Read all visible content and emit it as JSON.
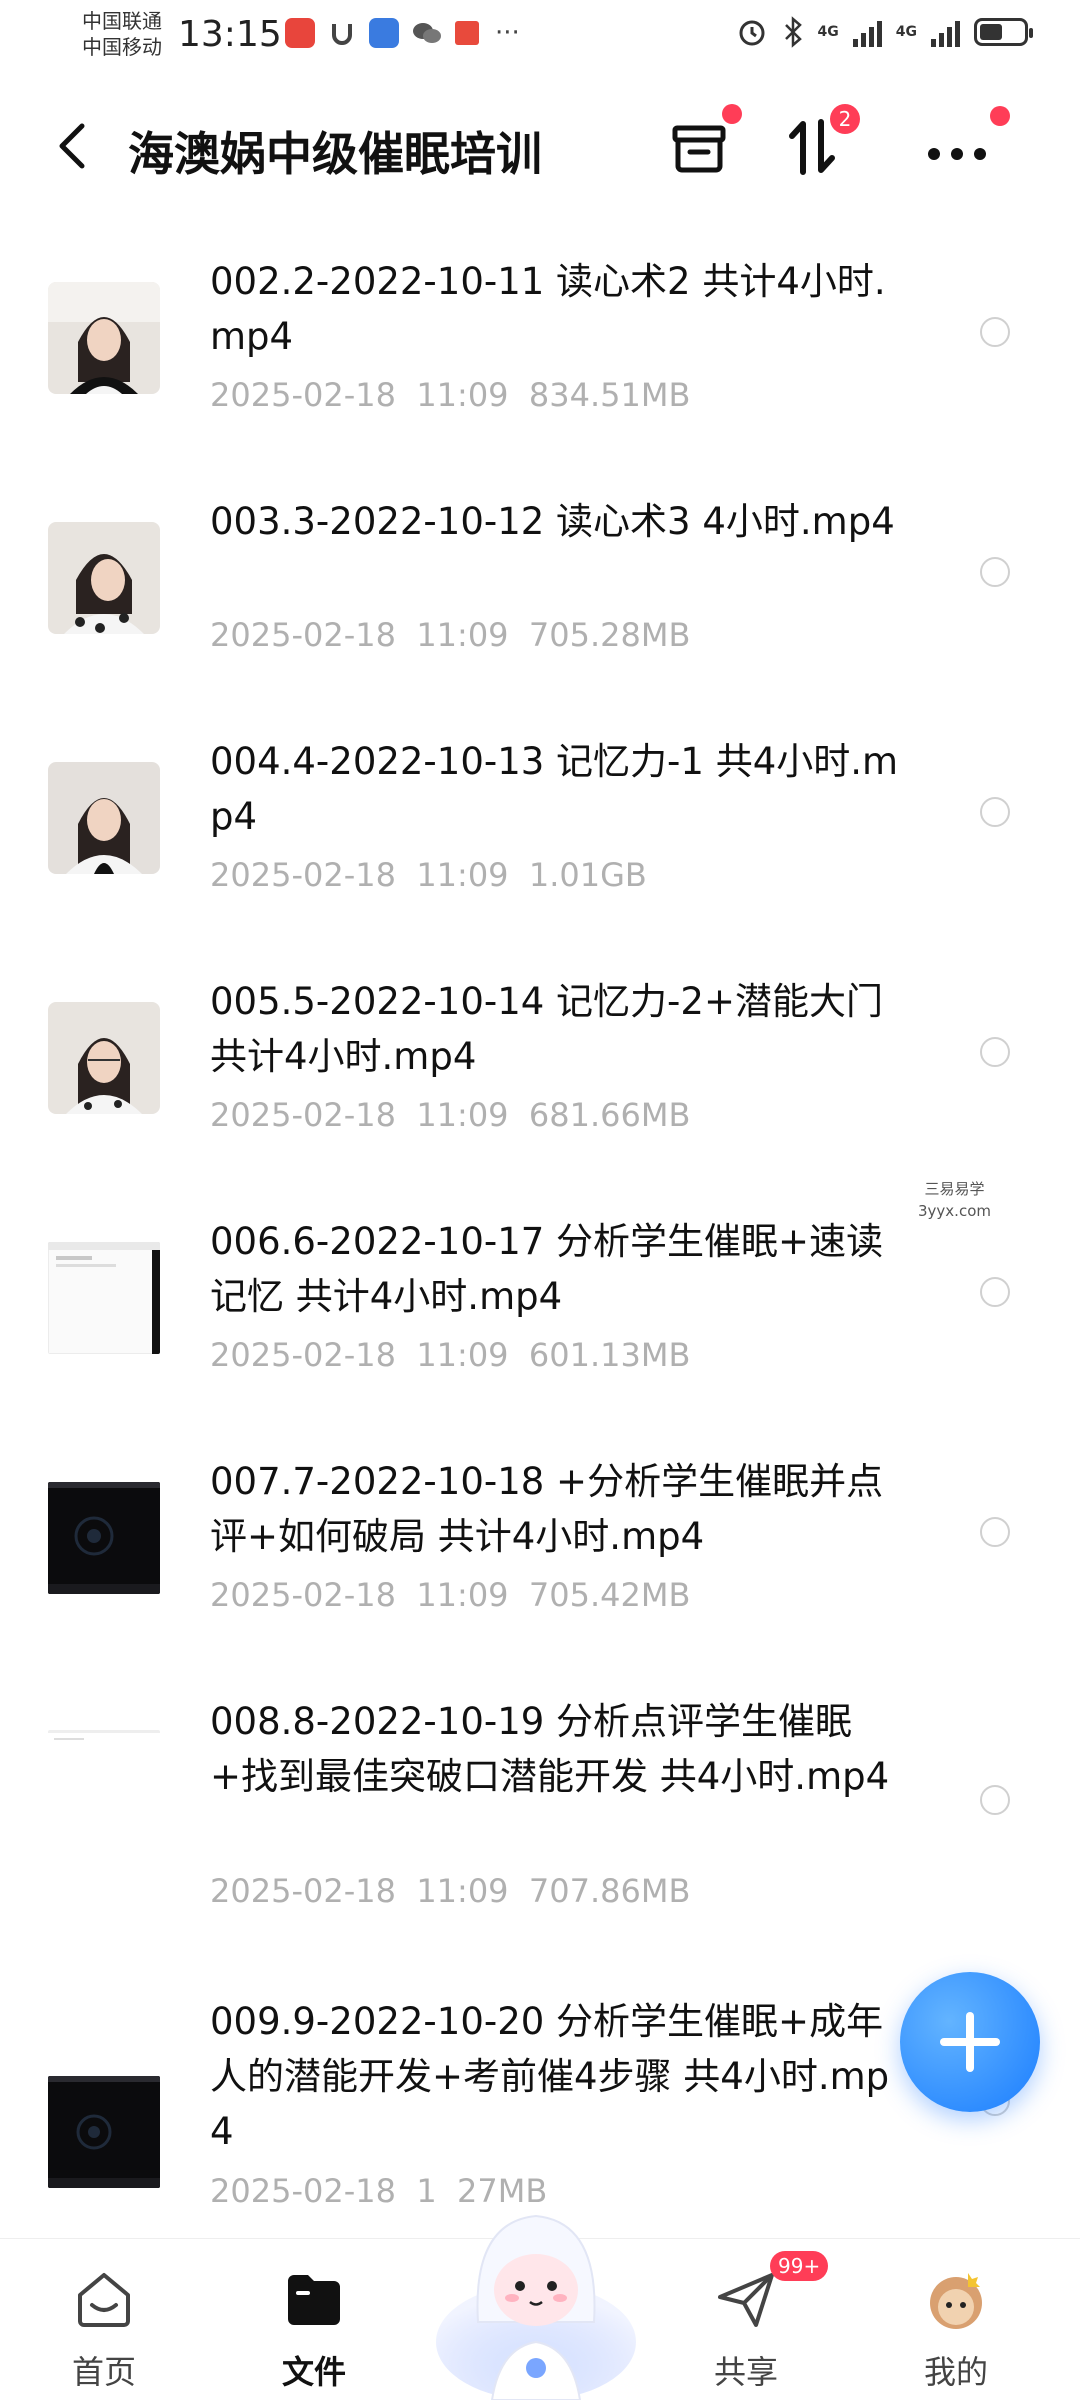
{
  "status_bar": {
    "carrier_1": "中国联通",
    "carrier_2": "中国移动",
    "time": "13:15",
    "network_1": "4G",
    "network_2": "4G"
  },
  "header": {
    "back_icon": "chevron-left-icon",
    "title": "海澳娲中级催眠培训",
    "transfer_badge": "2"
  },
  "files": [
    {
      "name": "002.2-2022-10-11 读心术2 共计4小时.mp4",
      "date": "2025-02-18",
      "time": "11:09",
      "size": "834.51MB",
      "thumb": "portrait"
    },
    {
      "name": "003.3-2022-10-12 读心术3  4小时.mp4",
      "date": "2025-02-18",
      "time": "11:09",
      "size": "705.28MB",
      "thumb": "portrait"
    },
    {
      "name": "004.4-2022-10-13 记忆力-1 共4小时.mp4",
      "date": "2025-02-18",
      "time": "11:09",
      "size": "1.01GB",
      "thumb": "portrait"
    },
    {
      "name": "005.5-2022-10-14 记忆力-2+潜能大门  共计4小时.mp4",
      "date": "2025-02-18",
      "time": "11:09",
      "size": "681.66MB",
      "thumb": "portrait"
    },
    {
      "name": "006.6-2022-10-17 分析学生催眠+速读记忆 共计4小时.mp4",
      "date": "2025-02-18",
      "time": "11:09",
      "size": "601.13MB",
      "thumb": "screen-light"
    },
    {
      "name": "007.7-2022-10-18 +分析学生催眠并点评+如何破局 共计4小时.mp4",
      "date": "2025-02-18",
      "time": "11:09",
      "size": "705.42MB",
      "thumb": "screen-dark"
    },
    {
      "name": "008.8-2022-10-19 分析点评学生催眠+找到最佳突破口潜能开发 共4小时.mp4",
      "date": "2025-02-18",
      "time": "11:09",
      "size": "707.86MB",
      "thumb": "blank"
    },
    {
      "name": "009.9-2022-10-20 分析学生催眠+成年人的潜能开发+考前催4步骤 共4小时.mp4",
      "date": "2025-02-18",
      "time": "1",
      "size": "27MB",
      "thumb": "screen-dark"
    }
  ],
  "watermark": {
    "line1": "三易易学",
    "line2": "3yyx.com"
  },
  "tabs": [
    {
      "label": "首页",
      "icon": "home-icon",
      "active": false
    },
    {
      "label": "文件",
      "icon": "folder-icon",
      "active": true
    },
    {
      "label": "共享",
      "icon": "paper-plane-icon",
      "active": false,
      "badge": "99+"
    },
    {
      "label": "我的",
      "icon": "avatar-icon",
      "active": false
    }
  ],
  "fab": {
    "icon": "plus-icon"
  },
  "colors": {
    "accent": "#1a7dff",
    "badge": "#ff3d57",
    "meta_text": "#b0b0b0"
  }
}
